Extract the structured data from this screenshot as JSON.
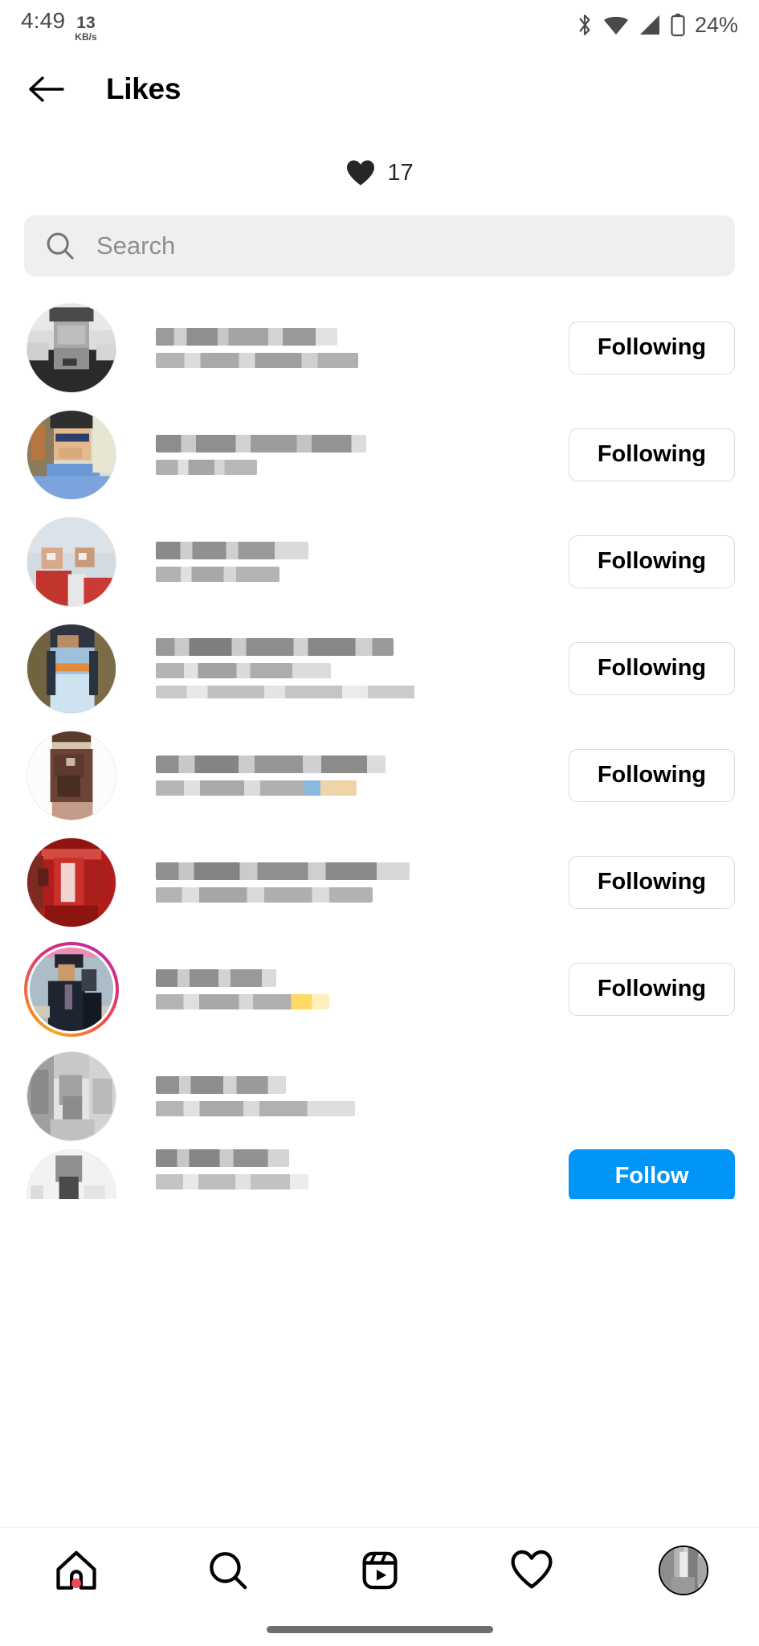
{
  "status_bar": {
    "time": "4:49",
    "network_speed_value": "13",
    "network_speed_unit": "KB/s",
    "battery_percent": "24%",
    "icons": [
      "bluetooth-icon",
      "wifi-icon",
      "cellular-signal-icon",
      "battery-icon"
    ]
  },
  "header": {
    "back_icon": "back-arrow-icon",
    "title": "Likes"
  },
  "like_summary": {
    "icon": "heart-filled-icon",
    "count": "17"
  },
  "search": {
    "icon": "search-icon",
    "placeholder": "Search",
    "value": ""
  },
  "colors": {
    "follow_blue": "#0095F6",
    "border_gray": "#dbdbdb",
    "field_gray": "#efefef",
    "badge_red": "#ed4956"
  },
  "users": [
    {
      "username": "",
      "full_name": "",
      "subtitle": "",
      "button_label": "Following",
      "button_style": "outline",
      "has_story_ring": false,
      "redacted": true
    },
    {
      "username": "",
      "full_name": "",
      "subtitle": "",
      "button_label": "Following",
      "button_style": "outline",
      "has_story_ring": false,
      "redacted": true
    },
    {
      "username": "",
      "full_name": "",
      "subtitle": "",
      "button_label": "Following",
      "button_style": "outline",
      "has_story_ring": false,
      "redacted": true
    },
    {
      "username": "",
      "full_name": "",
      "subtitle": "",
      "button_label": "Following",
      "button_style": "outline",
      "has_story_ring": false,
      "redacted": true
    },
    {
      "username": "",
      "full_name": "",
      "subtitle": "",
      "button_label": "Following",
      "button_style": "outline",
      "has_story_ring": false,
      "redacted": true
    },
    {
      "username": "",
      "full_name": "",
      "subtitle": "",
      "button_label": "Following",
      "button_style": "outline",
      "has_story_ring": false,
      "redacted": true
    },
    {
      "username": "",
      "full_name": "",
      "subtitle": "",
      "button_label": "Following",
      "button_style": "outline",
      "has_story_ring": true,
      "redacted": true
    },
    {
      "username": "",
      "full_name": "",
      "subtitle": "",
      "button_label": "",
      "button_style": "none",
      "has_story_ring": false,
      "redacted": true
    },
    {
      "username": "",
      "full_name": "",
      "subtitle": "",
      "button_label": "Follow",
      "button_style": "primary",
      "has_story_ring": false,
      "redacted": true
    }
  ],
  "bottom_nav": [
    {
      "name": "home",
      "icon": "home-icon",
      "badge": true
    },
    {
      "name": "search",
      "icon": "search-icon",
      "badge": false
    },
    {
      "name": "reels",
      "icon": "reels-icon",
      "badge": false
    },
    {
      "name": "activity",
      "icon": "heart-outline-icon",
      "badge": false
    },
    {
      "name": "profile",
      "icon": "profile-avatar-icon",
      "badge": false
    }
  ],
  "home_indicator": "home-indicator"
}
